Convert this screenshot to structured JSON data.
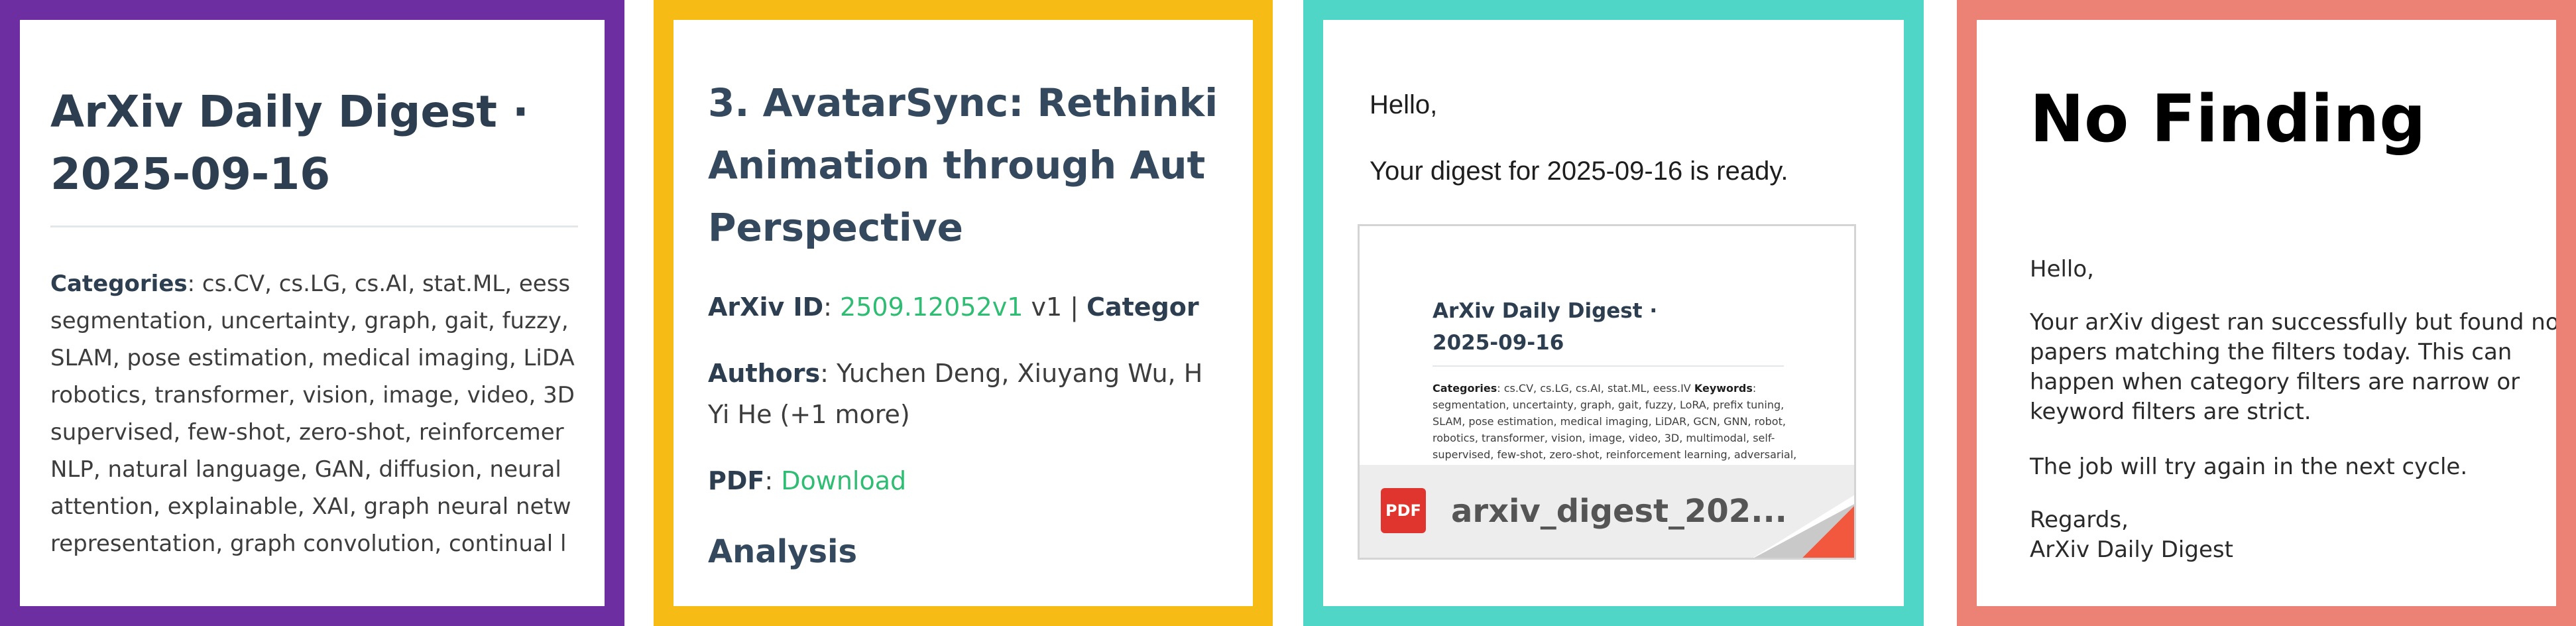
{
  "panel1": {
    "title_line1": "ArXiv Daily Digest ·",
    "title_line2": "2025-09-16",
    "categories_label": "Categories",
    "lines": [
      ": cs.CV, cs.LG, cs.AI, stat.ML, eess",
      "segmentation, uncertainty, graph, gait, fuzzy,",
      "SLAM, pose estimation, medical imaging, LiDA",
      "robotics, transformer, vision, image, video, 3D",
      "supervised, few-shot, zero-shot, reinforcemer",
      "NLP, natural language, GAN, diffusion, neural",
      "attention, explainable, XAI, graph neural netw",
      "representation, graph convolution, continual l"
    ]
  },
  "panel2": {
    "title_lines": [
      "3. AvatarSync: Rethinki",
      "Animation through Aut",
      "Perspective"
    ],
    "arxiv_id_label": "ArXiv ID",
    "arxiv_id_value": "2509.12052v1",
    "version_sep": " v1 | ",
    "categories_label": "Categor",
    "authors_label": "Authors",
    "authors_line1": ": Yuchen Deng, Xiuyang Wu, H",
    "authors_line2": "Yi He (+1 more)",
    "pdf_label": "PDF",
    "pdf_link": "Download",
    "analysis_heading": "Analysis"
  },
  "panel3": {
    "greeting": "Hello,",
    "message": "Your digest for 2025-09-16 is ready.",
    "attachment": {
      "preview_title_line1": "ArXiv Daily Digest ·",
      "preview_title_line2": "2025-09-16",
      "preview_categories_label": "Categories",
      "preview_categories_value": ": cs.CV, cs.LG, cs.AI, stat.ML, eess.IV ",
      "preview_keywords_label": "Keywords",
      "preview_lines": [
        "segmentation, uncertainty, graph, gait, fuzzy, LoRA, prefix tuning,",
        "SLAM, pose estimation, medical imaging, LiDAR, GCN, GNN, robot,",
        "robotics, transformer, vision, image, video, 3D, multimodal, self-",
        "supervised, few-shot, zero-shot, reinforcement learning, adversarial,"
      ],
      "file_icon_label": "PDF",
      "file_name": "arxiv_digest_202..."
    },
    "colors": {
      "pdf_red": "#e0352e"
    }
  },
  "panel4": {
    "title": "No Finding",
    "greeting": "Hello,",
    "body_lines": [
      "Your arXiv digest ran successfully but found no",
      "papers matching the filters today. This can",
      "happen when category filters are narrow or",
      "keyword filters are strict."
    ],
    "retry": "The job will try again in the next cycle.",
    "regards": "Regards,",
    "signature": "ArXiv Daily Digest"
  },
  "border_colors": [
    "#6d2ea2",
    "#f7bb16",
    "#4fd6c6",
    "#ec8175"
  ]
}
